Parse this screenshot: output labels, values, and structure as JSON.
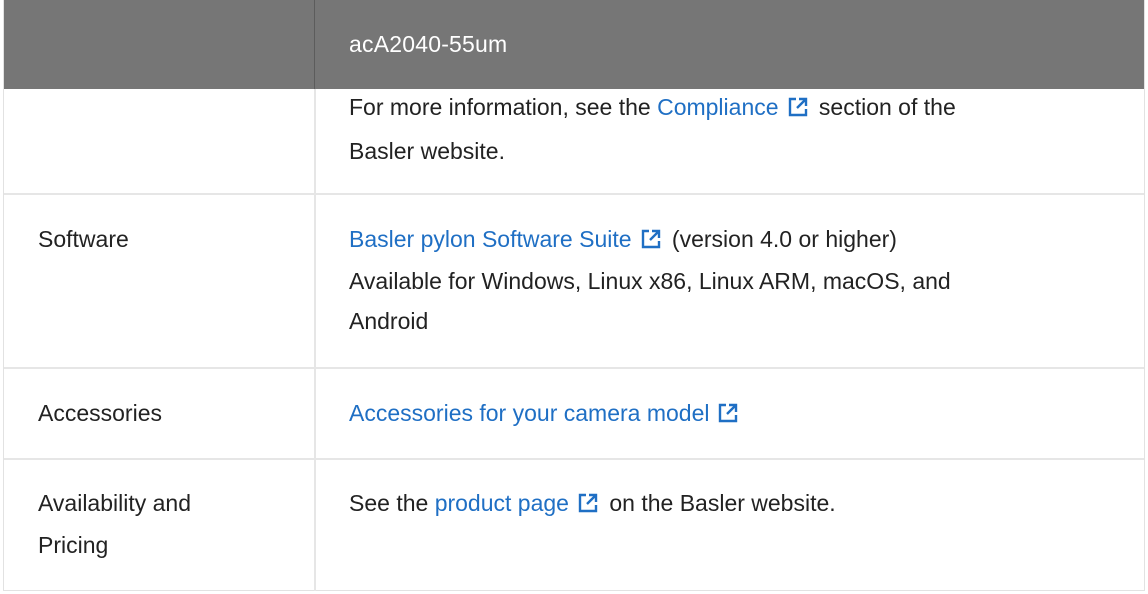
{
  "header": {
    "model": "acA2040-55um"
  },
  "rows": [
    {
      "label": "",
      "before": "For more information, see the ",
      "link": "Compliance",
      "after": " section of the",
      "line2": "Basler website."
    },
    {
      "label": "Software",
      "link": "Basler pylon Software Suite",
      "after": " (version 4.0 or higher)",
      "line2": "Available for Windows, Linux x86, Linux ARM, macOS, and",
      "line3": "Android"
    },
    {
      "label": "Accessories",
      "link": "Accessories for your camera model"
    },
    {
      "label_line1": "Availability and",
      "label_line2": "Pricing",
      "before": "See the ",
      "link": "product page",
      "after": " on the Basler website."
    }
  ],
  "icons": {
    "external": "external-link-icon"
  },
  "colors": {
    "header_bg": "#767676",
    "link": "#1f6fc4",
    "border": "#e6e6e6"
  }
}
